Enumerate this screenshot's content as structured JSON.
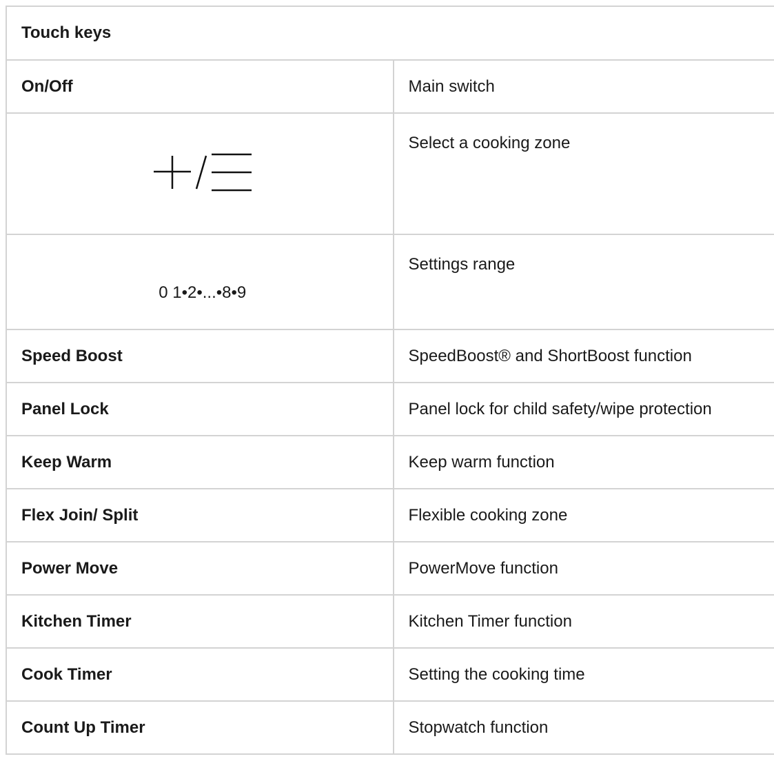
{
  "table": {
    "header": "Touch keys",
    "rows": [
      {
        "key": "On/Off",
        "desc": "Main switch"
      },
      {
        "key_symbol": "plus-slash-minus-icon",
        "desc": "Select a cooking zone"
      },
      {
        "key_text": "0 1•2•...•8•9",
        "desc": "Settings range"
      },
      {
        "key": "Speed Boost",
        "desc": "SpeedBoost® and ShortBoost function"
      },
      {
        "key": "Panel Lock",
        "desc": "Panel lock for child safety/wipe protection"
      },
      {
        "key": "Keep Warm",
        "desc": "Keep warm function"
      },
      {
        "key": "Flex Join/ Split",
        "desc": "Flexible cooking zone"
      },
      {
        "key": "Power Move",
        "desc": "PowerMove function"
      },
      {
        "key": "Kitchen Timer",
        "desc": "Kitchen Timer function"
      },
      {
        "key": "Cook Timer",
        "desc": "Setting the cooking time"
      },
      {
        "key": "Count Up Timer",
        "desc": "Stopwatch function"
      }
    ]
  },
  "colors": {
    "border": "#d3d3d3",
    "text": "#1a1a1a",
    "background": "#ffffff"
  }
}
